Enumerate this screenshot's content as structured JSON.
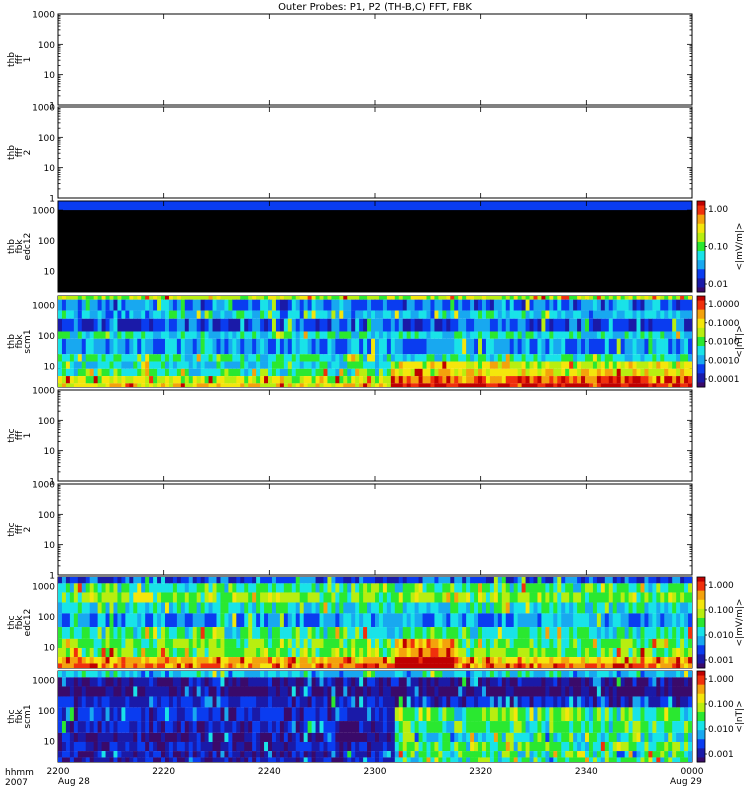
{
  "title": "Outer Probes: P1, P2 (TH-B,C) FFT, FBK",
  "x_axis": {
    "row_label_1": "hhmm",
    "row_label_2": "2007",
    "ticks": [
      "2200",
      "2220",
      "2240",
      "2300",
      "2320",
      "2340",
      "0000"
    ],
    "start_date": "Aug 28",
    "end_date": "Aug 29"
  },
  "chart_data": {
    "type": "heatmap",
    "x_range": [
      "2200",
      "0000"
    ],
    "panels": [
      {
        "id": "p1",
        "ylabel": [
          "thb",
          "fff",
          "1"
        ],
        "yscale": "log",
        "ylim": [
          1,
          1000
        ],
        "yticks": [
          "1000",
          "100",
          "10",
          "1"
        ],
        "colorbar": null,
        "fill": "none"
      },
      {
        "id": "p2",
        "ylabel": [
          "thb",
          "fff",
          "2"
        ],
        "yscale": "log",
        "ylim": [
          1,
          1000
        ],
        "yticks": [
          "1000",
          "100",
          "10",
          "1"
        ],
        "colorbar": null,
        "fill": "none"
      },
      {
        "id": "p3",
        "ylabel": [
          "thb",
          "fbk",
          "edc12"
        ],
        "yscale": "log",
        "ylim": [
          2,
          2000
        ],
        "yticks": [
          "1000",
          "100",
          "10"
        ],
        "colorbar": {
          "label": "<|mV/m|>",
          "ticks": [
            "1.00",
            "0.10",
            "0.01"
          ]
        },
        "fill": "black-with-blue-top"
      },
      {
        "id": "p4",
        "ylabel": [
          "thb",
          "fbk",
          "scm1"
        ],
        "yscale": "log",
        "ylim": [
          2,
          2000
        ],
        "yticks": [
          "1000",
          "100",
          "10"
        ],
        "colorbar": {
          "label": "<|nT|>",
          "ticks": [
            "1.0000",
            "0.1000",
            "0.0100",
            "0.0010",
            "0.0001"
          ]
        },
        "fill": "spectrogram-b"
      },
      {
        "id": "p5",
        "ylabel": [
          "thc",
          "fff",
          "1"
        ],
        "yscale": "log",
        "ylim": [
          1,
          1000
        ],
        "yticks": [
          "1000",
          "100",
          "10",
          "1"
        ],
        "colorbar": null,
        "fill": "none"
      },
      {
        "id": "p6",
        "ylabel": [
          "thc",
          "fff",
          "2"
        ],
        "yscale": "log",
        "ylim": [
          1,
          1000
        ],
        "yticks": [
          "1000",
          "100",
          "10",
          "1"
        ],
        "colorbar": null,
        "fill": "none"
      },
      {
        "id": "p7",
        "ylabel": [
          "thc",
          "fbk",
          "edc12"
        ],
        "yscale": "log",
        "ylim": [
          2,
          2000
        ],
        "yticks": [
          "1000",
          "100",
          "10"
        ],
        "colorbar": {
          "label": "<|mV/m|>",
          "ticks": [
            "1.000",
            "0.100",
            "0.010",
            "0.001"
          ]
        },
        "fill": "spectrogram-c-edc"
      },
      {
        "id": "p8",
        "ylabel": [
          "thc",
          "fbk",
          "scm1"
        ],
        "yscale": "log",
        "ylim": [
          2,
          2000
        ],
        "yticks": [
          "1000",
          "100",
          "10"
        ],
        "colorbar": {
          "label": "<|nT|>",
          "ticks": [
            "1.000",
            "0.100",
            "0.010",
            "0.001"
          ]
        },
        "fill": "spectrogram-c-scm"
      }
    ]
  },
  "colors": {
    "frame": "#000000",
    "background": "#ffffff",
    "colormap": [
      "#3a0a6a",
      "#1a1aa8",
      "#0a3cf0",
      "#18a8f0",
      "#19e3e8",
      "#2ae830",
      "#b8ee10",
      "#f4e60c",
      "#f4a20c",
      "#f0300c",
      "#c00000"
    ]
  }
}
